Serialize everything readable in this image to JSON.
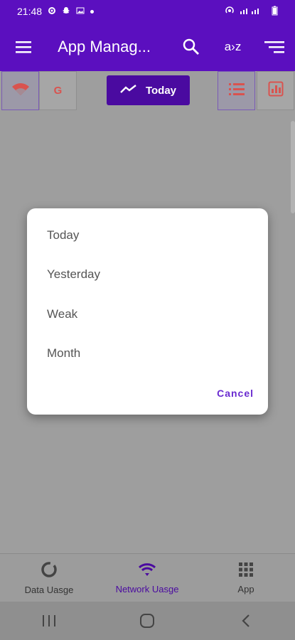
{
  "status_bar": {
    "time": "21:48"
  },
  "toolbar": {
    "title": "App Manag...",
    "sort_az_label": "a›z",
    "icons": [
      "menu-icon",
      "search-icon",
      "sort-az-icon",
      "filter-sort-icon"
    ]
  },
  "filters": {
    "wifi_icon": "wifi-icon",
    "g_label": "G",
    "today_label": "Today",
    "list_icon": "list-icon",
    "chart_icon": "bar-chart-icon"
  },
  "dialog": {
    "options": [
      "Today",
      "Yesterday",
      "Weak",
      "Month"
    ],
    "cancel_label": "Cancel"
  },
  "bottom_nav": {
    "items": [
      {
        "label": "Data Uasge",
        "icon": "donut-icon"
      },
      {
        "label": "Network Uasge",
        "icon": "wifi-signal-icon"
      },
      {
        "label": "App",
        "icon": "grid-icon"
      }
    ]
  },
  "colors": {
    "primary": "#5b0fbf",
    "accent": "#4a0aa0",
    "cancel": "#6a2bd0",
    "icon_red": "#d9534f"
  }
}
